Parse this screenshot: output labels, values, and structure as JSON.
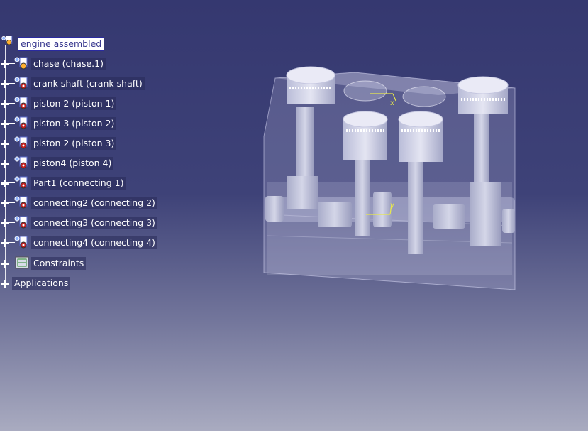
{
  "tree": {
    "root": {
      "label": "engine assembled",
      "icon": "product-icon"
    },
    "items": [
      {
        "label": "chase (chase.1)",
        "icon": "product-icon"
      },
      {
        "label": "crank shaft (crank shaft)",
        "icon": "part-icon"
      },
      {
        "label": "piston 2 (piston 1)",
        "icon": "part-icon"
      },
      {
        "label": "piston 3 (piston 2)",
        "icon": "part-icon"
      },
      {
        "label": "piston 2 (piston 3)",
        "icon": "part-icon"
      },
      {
        "label": "piston4 (piston 4)",
        "icon": "part-icon"
      },
      {
        "label": "Part1 (connecting 1)",
        "icon": "part-icon"
      },
      {
        "label": "connecting2 (connecting 2)",
        "icon": "part-icon"
      },
      {
        "label": "connecting3 (connecting 3)",
        "icon": "part-icon"
      },
      {
        "label": "connecting4 (connecting 4)",
        "icon": "part-icon"
      }
    ],
    "constraints": {
      "label": "Constraints",
      "icon": "constraints-icon"
    },
    "applications": {
      "label": "Applications"
    }
  },
  "viewport": {
    "model": "engine assembly (transparent block with four pistons and crankshaft)",
    "axis_labels": {
      "x": "x",
      "y": "y"
    }
  },
  "colors": {
    "background_top": "#353870",
    "background_bottom": "#a9abc0",
    "selection_fill": "#ffffff",
    "selection_text": "#3a3a90",
    "axis": "#e8e84a",
    "part_gear_red": "#c02020"
  }
}
